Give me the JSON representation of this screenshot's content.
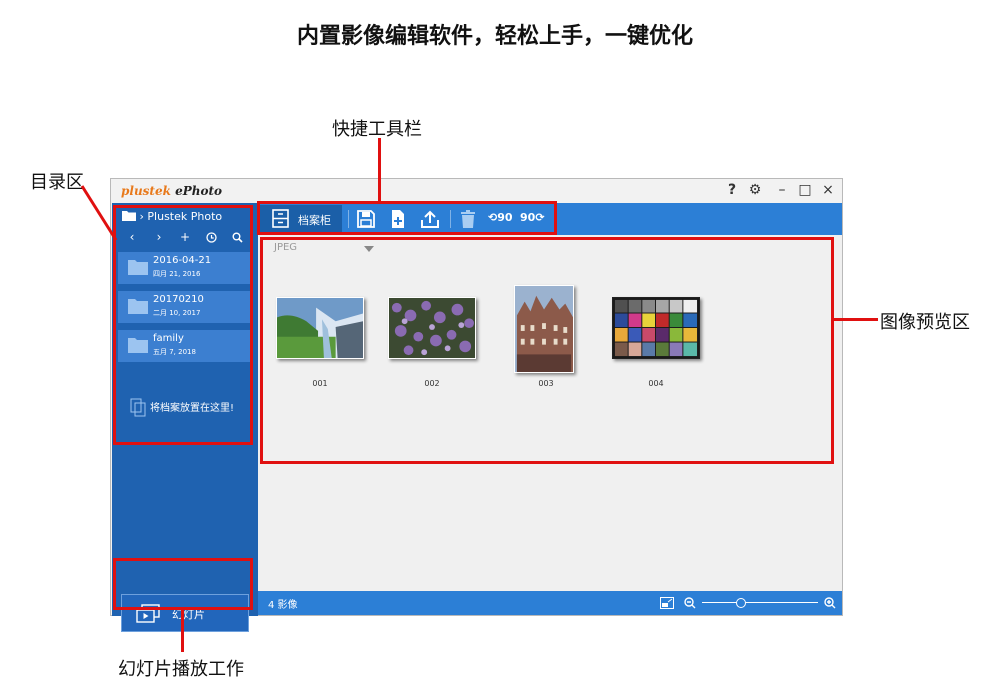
{
  "headline": "内置影像编辑软件，轻松上手，一键优化",
  "callouts": {
    "toolbar": "快捷工具栏",
    "directory": "目录区",
    "preview": "图像预览区",
    "slideshow": "幻灯片播放工作"
  },
  "app": {
    "brand": "plustek",
    "product": "ePhoto",
    "window_controls": [
      "?",
      "⚙",
      "–",
      "□",
      "×"
    ]
  },
  "sidebar": {
    "path": "Plustek Photo",
    "nav_icons": [
      "back-icon",
      "forward-icon",
      "add-icon",
      "history-icon",
      "search-icon"
    ],
    "folders": [
      {
        "name": "2016-04-21",
        "date": "四月 21, 2016"
      },
      {
        "name": "20170210",
        "date": "二月 10, 2017"
      },
      {
        "name": "family",
        "date": "五月 7, 2018"
      }
    ],
    "drop_hint": "将档案放置在这里!",
    "slideshow_label": "幻灯片"
  },
  "toolbar": {
    "archive_label": "档案柜",
    "buttons": [
      "save-icon",
      "add-file-icon",
      "upload-icon",
      "delete-icon",
      "rotate-left-icon",
      "rotate-right-icon"
    ],
    "rotate_left_text": "90",
    "rotate_right_text": "90"
  },
  "main": {
    "filter_value": "JPEG",
    "thumbnails": [
      {
        "caption": "001"
      },
      {
        "caption": "002"
      },
      {
        "caption": "003"
      },
      {
        "caption": "004"
      }
    ]
  },
  "status": {
    "count": "4 影像"
  },
  "colors": {
    "sidebar": "#1f62b0",
    "toolbar": "#2c7fd6",
    "highlight": "#e01010",
    "brand": "#e8791b"
  }
}
